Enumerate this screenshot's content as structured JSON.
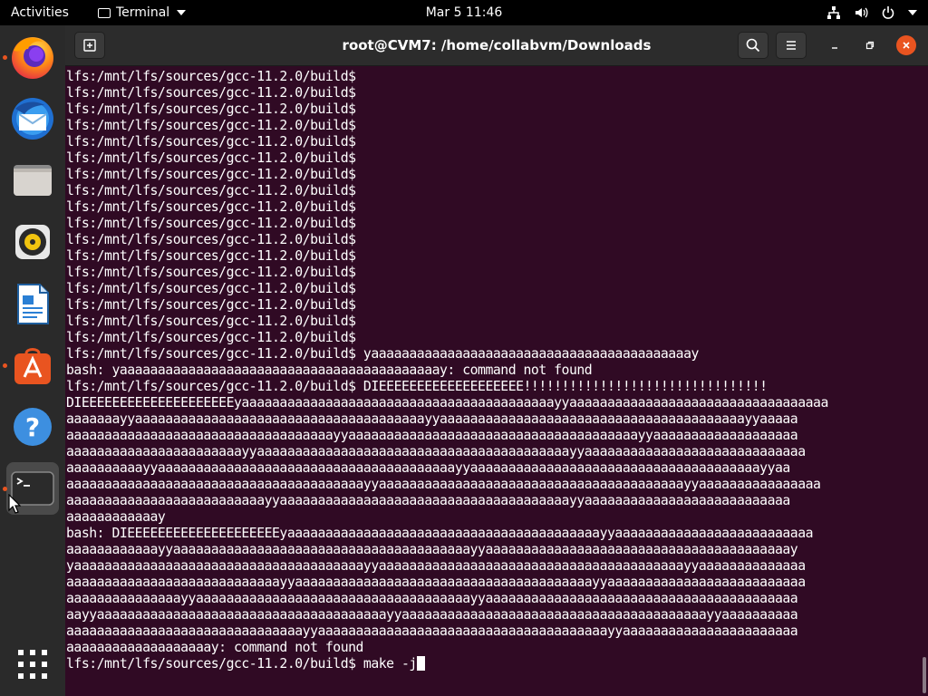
{
  "topbar": {
    "activities": "Activities",
    "app_name": "Terminal",
    "clock": "Mar 5  11:46",
    "icons": [
      "network-icon",
      "volume-icon",
      "power-icon",
      "chevron-down-icon"
    ]
  },
  "dock": {
    "items": [
      {
        "name": "firefox",
        "icon": "firefox-icon",
        "running": true
      },
      {
        "name": "thunderbird",
        "icon": "thunderbird-icon",
        "running": false
      },
      {
        "name": "files",
        "icon": "files-icon",
        "running": false
      },
      {
        "name": "rhythmbox",
        "icon": "rhythmbox-icon",
        "running": false
      },
      {
        "name": "libreoffice-writer",
        "icon": "writer-icon",
        "running": false
      },
      {
        "name": "ubuntu-software",
        "icon": "software-icon",
        "running": true
      },
      {
        "name": "help",
        "icon": "help-icon",
        "running": false
      },
      {
        "name": "terminal",
        "icon": "terminal-icon",
        "running": true,
        "active": true
      }
    ],
    "show_apps_icon": "app-grid-icon"
  },
  "window": {
    "title": "root@CVM7: /home/collabvm/Downloads",
    "accent": "#e95420",
    "background": "#300a24"
  },
  "terminal": {
    "lines": [
      "lfs:/mnt/lfs/sources/gcc-11.2.0/build$",
      "lfs:/mnt/lfs/sources/gcc-11.2.0/build$",
      "lfs:/mnt/lfs/sources/gcc-11.2.0/build$",
      "lfs:/mnt/lfs/sources/gcc-11.2.0/build$",
      "lfs:/mnt/lfs/sources/gcc-11.2.0/build$",
      "lfs:/mnt/lfs/sources/gcc-11.2.0/build$",
      "lfs:/mnt/lfs/sources/gcc-11.2.0/build$",
      "lfs:/mnt/lfs/sources/gcc-11.2.0/build$",
      "lfs:/mnt/lfs/sources/gcc-11.2.0/build$",
      "lfs:/mnt/lfs/sources/gcc-11.2.0/build$",
      "lfs:/mnt/lfs/sources/gcc-11.2.0/build$",
      "lfs:/mnt/lfs/sources/gcc-11.2.0/build$",
      "lfs:/mnt/lfs/sources/gcc-11.2.0/build$",
      "lfs:/mnt/lfs/sources/gcc-11.2.0/build$",
      "lfs:/mnt/lfs/sources/gcc-11.2.0/build$",
      "lfs:/mnt/lfs/sources/gcc-11.2.0/build$",
      "lfs:/mnt/lfs/sources/gcc-11.2.0/build$",
      "lfs:/mnt/lfs/sources/gcc-11.2.0/build$ yaaaaaaaaaaaaaaaaaaaaaaaaaaaaaaaaaaaaaaaaaay",
      "bash: yaaaaaaaaaaaaaaaaaaaaaaaaaaaaaaaaaaaaaaaaaay: command not found",
      "lfs:/mnt/lfs/sources/gcc-11.2.0/build$ DIEEEEEEEEEEEEEEEEEEE!!!!!!!!!!!!!!!!!!!!!!!!!!!!!!!!",
      "DIEEEEEEEEEEEEEEEEEEEEyaaaaaaaaaaaaaaaaaaaaaaaaaaaaaaaaaaaaaaaaayyaaaaaaaaaaaaaaaaaaaaaaaaaaaaaaaaaa",
      "aaaaaaayyaaaaaaaaaaaaaaaaaaaaaaaaaaaaaaaaaaaaaayyaaaaaaaaaaaaaaaaaaaaaaaaaaaaaaaaaaaaaaaayyaaaaa",
      "aaaaaaaaaaaaaaaaaaaaaaaaaaaaaaaaaaayyaaaaaaaaaaaaaaaaaaaaaaaaaaaaaaaaaaaaaayyaaaaaaaaaaaaaaaaaaa",
      "aaaaaaaaaaaaaaaaaaaaaaayyaaaaaaaaaaaaaaaaaaaaaaaaaaaaaaaaaaaaaaaaayyaaaaaaaaaaaaaaaaaaaaaaaaaaaaa",
      "aaaaaaaaaayyaaaaaaaaaaaaaaaaaaaaaaaaaaaaaaaaaaaaaaayyaaaaaaaaaaaaaaaaaaaaaaaaaaaaaaaaaaaaaayyaa",
      "aaaaaaaaaaaaaaaaaaaaaaaaaaaaaaaaaaaaaaayyaaaaaaaaaaaaaaaaaaaaaaaaaaaaaaaaaaaaaaaayyaaaaaaaaaaaaaaaa",
      "aaaaaaaaaaaaaaaaaaaaaaaaaayyaaaaaaaaaaaaaaaaaaaaaaaaaaaaaaaaaaaaaayyaaaaaaaaaaaaaaaaaaaaaaaaaaa",
      "aaaaaaaaaaaay",
      "bash: DIEEEEEEEEEEEEEEEEEEEEyaaaaaaaaaaaaaaaaaaaaaaaaaaaaaaaaaaaaaaaaayyaaaaaaaaaaaaaaaaaaaaaaaaaa",
      "aaaaaaaaaaaayyaaaaaaaaaaaaaaaaaaaaaaaaaaaaaaaaaaaaaaayyaaaaaaaaaaaaaaaaaaaaaaaaaaaaaaaaaaaaaaaay",
      "yaaaaaaaaaaaaaaaaaaaaaaaaaaaaaaaaaaaaaayyaaaaaaaaaaaaaaaaaaaaaaaaaaaaaaaaaaaaaaaayyaaaaaaaaaaaaaa",
      "aaaaaaaaaaaaaaaaaaaaaaaaaaaayyaaaaaaaaaaaaaaaaaaaaaaaaaaaaaaaaaaaaaaayyaaaaaaaaaaaaaaaaaaaaaaaaaa",
      "aaaaaaaaaaaaaaayyaaaaaaaaaaaaaaaaaaaaaaaaaaaaaaaaaaaayyaaaaaaaaaaaaaaaaaaaaaaaaaaaaaaaaaaaaaaaaa",
      "aayyaaaaaaaaaaaaaaaaaaaaaaaaaaaaaaaaaaaaaayyaaaaaaaaaaaaaaaaaaaaaaaaaaaaaaaaaaaaaaaayyaaaaaaaaaa",
      "aaaaaaaaaaaaaaaaaaaaaaaaaaaaaaayyaaaaaaaaaaaaaaaaaaaaaaaaaaaaaaaaaaaaaayyaaaaaaaaaaaaaaaaaaaaaaa",
      "aaaaaaaaaaaaaaaaaaay: command not found"
    ],
    "current_prompt": "lfs:/mnt/lfs/sources/gcc-11.2.0/build$ make -j"
  }
}
